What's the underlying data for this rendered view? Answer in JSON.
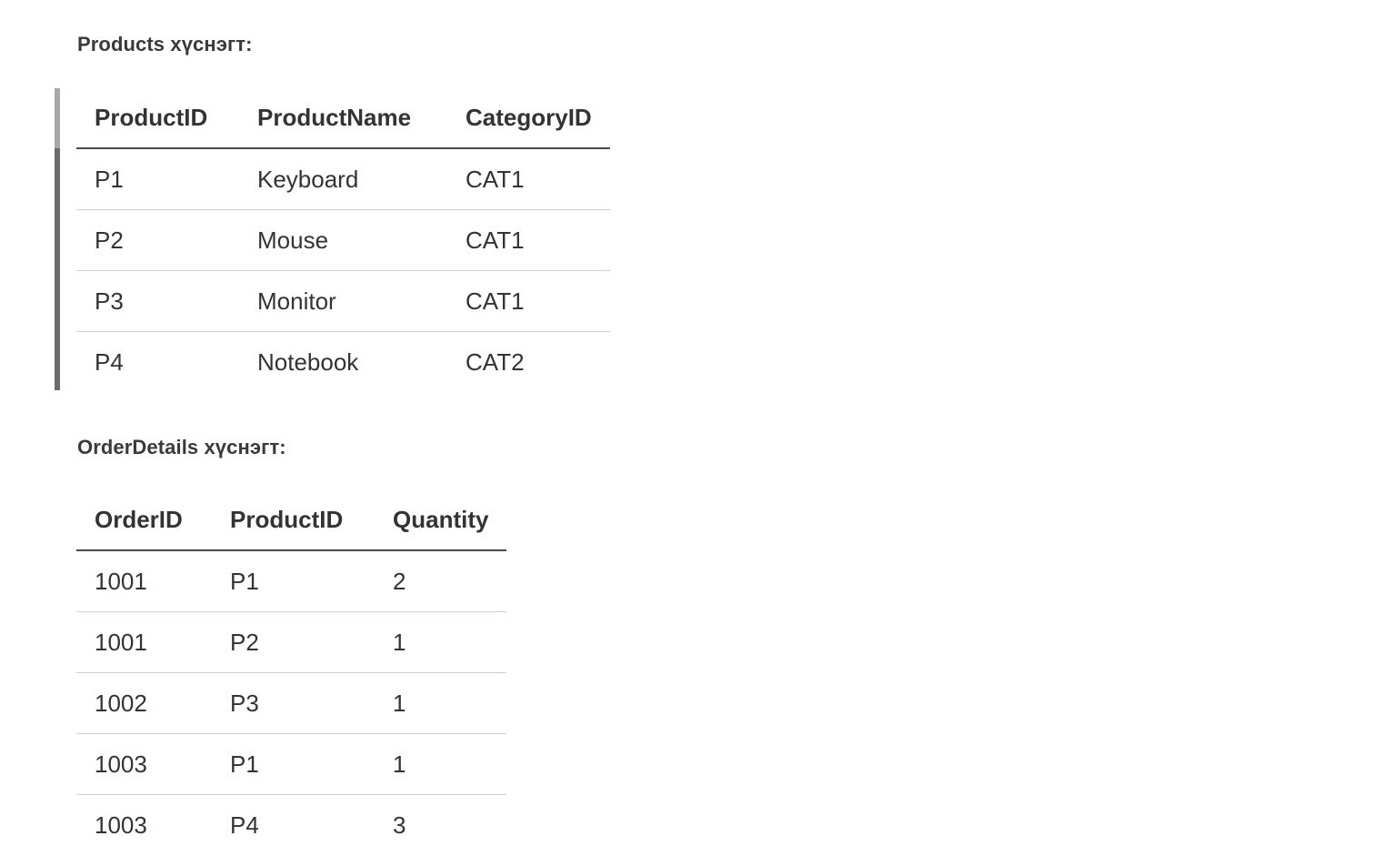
{
  "products": {
    "title": "Products хүснэгт:",
    "headers": [
      "ProductID",
      "ProductName",
      "CategoryID"
    ],
    "rows": [
      [
        "P1",
        "Keyboard",
        "CAT1"
      ],
      [
        "P2",
        "Mouse",
        "CAT1"
      ],
      [
        "P3",
        "Monitor",
        "CAT1"
      ],
      [
        "P4",
        "Notebook",
        "CAT2"
      ]
    ]
  },
  "order_details": {
    "title": "OrderDetails хүснэгт:",
    "headers": [
      "OrderID",
      "ProductID",
      "Quantity"
    ],
    "rows": [
      [
        "1001",
        "P1",
        "2"
      ],
      [
        "1001",
        "P2",
        "1"
      ],
      [
        "1002",
        "P3",
        "1"
      ],
      [
        "1003",
        "P1",
        "1"
      ],
      [
        "1003",
        "P4",
        "3"
      ]
    ]
  },
  "colors": {
    "text": "#333333",
    "header_rule": "#4a4a4a",
    "row_rule": "#cfcfcf",
    "scroll_track": "#6b6b6b",
    "scroll_thumb": "#a8a8a8"
  }
}
